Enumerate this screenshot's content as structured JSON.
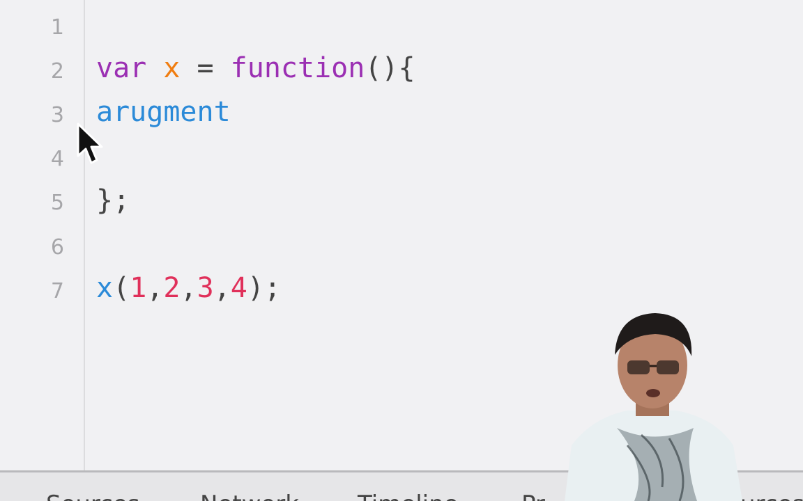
{
  "editor": {
    "line_numbers": [
      "1",
      "2",
      "3",
      "4",
      "5",
      "6",
      "7"
    ],
    "lines": [
      {
        "tokens": []
      },
      {
        "tokens": [
          {
            "text": "var ",
            "kind": "keyword"
          },
          {
            "text": "x",
            "kind": "var"
          },
          {
            "text": " = ",
            "kind": "plain"
          },
          {
            "text": "function",
            "kind": "keyword"
          },
          {
            "text": "(){",
            "kind": "plain"
          }
        ]
      },
      {
        "tokens": [
          {
            "text": "arugment",
            "kind": "fn"
          }
        ]
      },
      {
        "tokens": []
      },
      {
        "tokens": [
          {
            "text": "};",
            "kind": "plain"
          }
        ]
      },
      {
        "tokens": []
      },
      {
        "tokens": [
          {
            "text": "x",
            "kind": "fn"
          },
          {
            "text": "(",
            "kind": "plain"
          },
          {
            "text": "1",
            "kind": "num"
          },
          {
            "text": ",",
            "kind": "plain"
          },
          {
            "text": "2",
            "kind": "num"
          },
          {
            "text": ",",
            "kind": "plain"
          },
          {
            "text": "3",
            "kind": "num"
          },
          {
            "text": ",",
            "kind": "plain"
          },
          {
            "text": "4",
            "kind": "num"
          },
          {
            "text": ");",
            "kind": "plain"
          }
        ]
      }
    ]
  },
  "devtools_tabs": [
    {
      "label": "Sources"
    },
    {
      "label": "Network"
    },
    {
      "label": "Timeline"
    },
    {
      "label": "Pr"
    },
    {
      "label": "urces"
    }
  ],
  "colors": {
    "keyword": "#9b2fb3",
    "variable": "#f07d10",
    "function": "#2b8ad8",
    "number": "#e0305a",
    "line_number": "#a6a6a9",
    "background": "#f1f1f3"
  },
  "icons": {
    "cursor": "mouse-pointer-icon"
  }
}
